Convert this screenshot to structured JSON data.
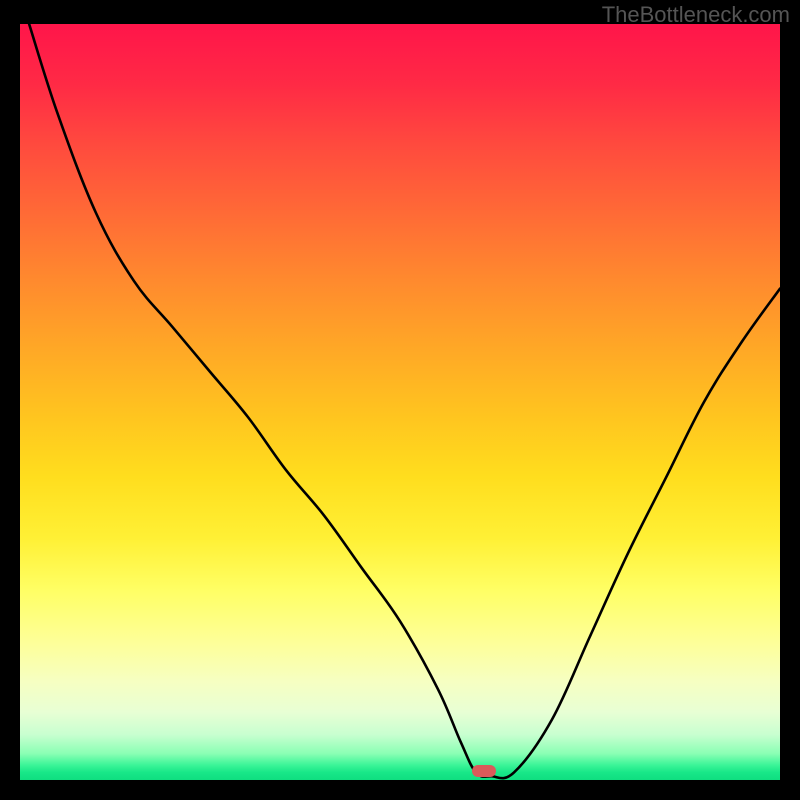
{
  "watermark": "TheBottleneck.com",
  "chart_data": {
    "type": "line",
    "title": "",
    "xlabel": "",
    "ylabel": "",
    "xlim": [
      0,
      100
    ],
    "ylim": [
      0,
      100
    ],
    "grid": false,
    "series": [
      {
        "name": "bottleneck-curve",
        "x": [
          1.2,
          5,
          10,
          15,
          20,
          25,
          30,
          35,
          40,
          45,
          50,
          55,
          58,
          60,
          62,
          65,
          70,
          75,
          80,
          85,
          90,
          95,
          100
        ],
        "values": [
          100,
          88,
          75,
          66,
          60,
          54,
          48,
          41,
          35,
          28,
          21,
          12,
          5,
          1,
          0.5,
          1,
          8,
          19,
          30,
          40,
          50,
          58,
          65
        ]
      }
    ],
    "marker": {
      "x": 61,
      "y": 0,
      "color": "#d95a5a"
    },
    "gradient_stops": [
      {
        "pos": 0,
        "color": "#ff154a"
      },
      {
        "pos": 25,
        "color": "#ff6a36"
      },
      {
        "pos": 52,
        "color": "#ffc51f"
      },
      {
        "pos": 75,
        "color": "#ffff65"
      },
      {
        "pos": 92,
        "color": "#d8ffd2"
      },
      {
        "pos": 100,
        "color": "#0fde80"
      }
    ]
  }
}
